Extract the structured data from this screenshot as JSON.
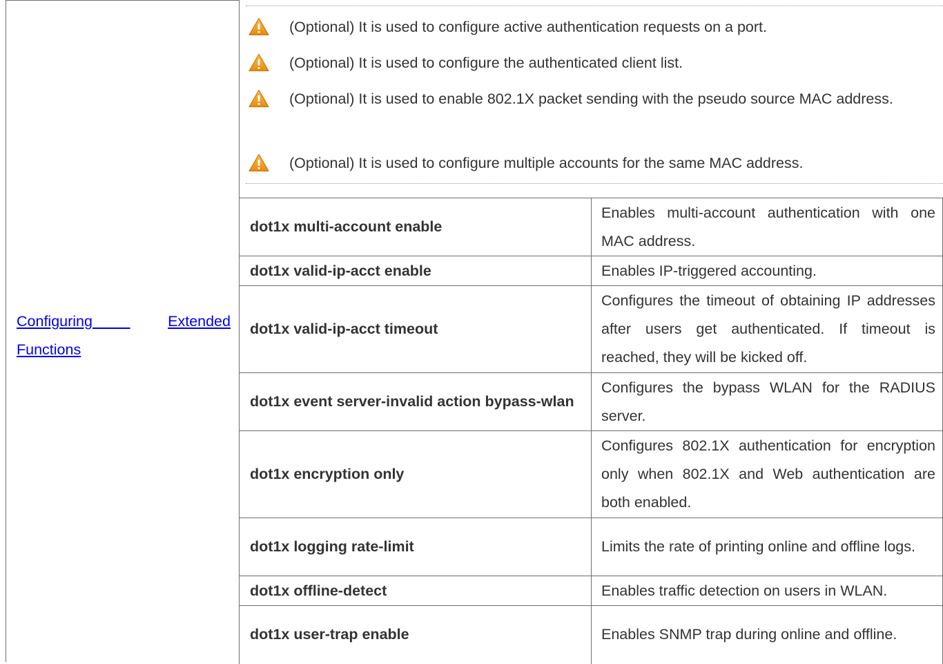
{
  "feature_link": {
    "line1_a": "Configuring",
    "line1_b": "Extended",
    "line2": "Functions"
  },
  "notes": [
    {
      "icon": "warning-icon",
      "text": "(Optional) It is used to configure active authentication requests on a port."
    },
    {
      "icon": "warning-icon",
      "text": "(Optional) It is used to configure the authenticated client list."
    },
    {
      "icon": "warning-icon",
      "text": "(Optional) It is used to enable 802.1X packet sending with the pseudo source MAC address."
    },
    {
      "icon": "warning-icon",
      "text": "(Optional) It is used to configure multiple accounts for the same MAC address."
    }
  ],
  "commands": [
    {
      "command": "dot1x multi-account enable",
      "description": "Enables multi-account authentication with one MAC address."
    },
    {
      "command": "dot1x valid-ip-acct enable",
      "description": "Enables IP-triggered accounting."
    },
    {
      "command": "dot1x valid-ip-acct timeout",
      "description": "Configures the timeout of obtaining IP addresses after users get authenticated. If timeout is reached, they will be kicked off."
    },
    {
      "command": "dot1x event server-invalid action bypass-wlan",
      "description": "Configures the bypass WLAN for the RADIUS server."
    },
    {
      "command": "dot1x encryption only",
      "description": "Configures 802.1X authentication for encryption only when 802.1X and Web authentication are both enabled."
    },
    {
      "command": "dot1x logging rate-limit",
      "description": "Limits the rate of printing online and offline logs."
    },
    {
      "command": "dot1x offline-detect",
      "description": "Enables traffic detection on users in WLAN."
    },
    {
      "command": "dot1x user-trap enable",
      "description": "Enables SNMP trap during online and offline."
    }
  ],
  "colors": {
    "link": "#0000ee",
    "warning_fill": "#f5a623",
    "border": "#6e6e6e",
    "text": "#333333"
  }
}
